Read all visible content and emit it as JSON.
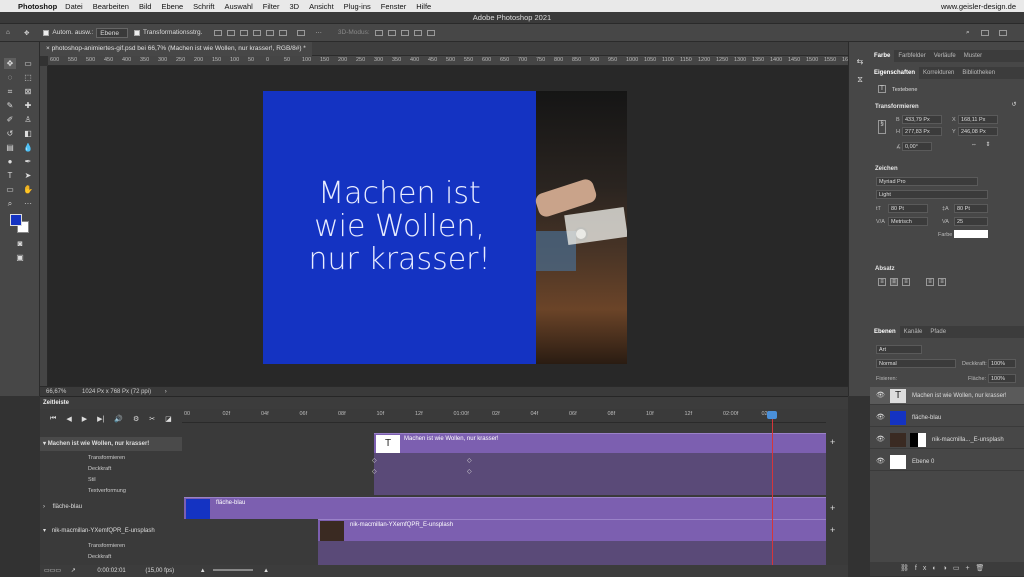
{
  "menubar": {
    "app": "Photoshop",
    "items": [
      "Datei",
      "Bearbeiten",
      "Bild",
      "Ebene",
      "Schrift",
      "Auswahl",
      "Filter",
      "3D",
      "Ansicht",
      "Plug-ins",
      "Fenster",
      "Hilfe"
    ],
    "right_text": "www.geisler-design.de"
  },
  "window_title": "Adobe Photoshop 2021",
  "options": {
    "auto_select_label": "Autom. ausw.:",
    "auto_select_value": "Ebene",
    "transform_label": "Transformationsstrg.",
    "mode_3d": "3D-Modus:"
  },
  "document": {
    "tab": "photoshop-animiertes-gif.psd bei 66,7% (Machen ist wie Wollen, nur krasser!, RGB/8#) *",
    "headline_line1": "Machen ist",
    "headline_line2": "wie Wollen,",
    "headline_line3": "nur krasser!",
    "zoom": "66,67%",
    "size": "1024 Px x 768 Px (72 ppi)",
    "ruler_labels": [
      "600",
      "550",
      "500",
      "450",
      "400",
      "350",
      "300",
      "250",
      "200",
      "150",
      "100",
      "50",
      "0",
      "50",
      "100",
      "150",
      "200",
      "250",
      "300",
      "350",
      "400",
      "450",
      "500",
      "550",
      "600",
      "650",
      "700",
      "750",
      "800",
      "850",
      "900",
      "950",
      "1000",
      "1050",
      "1100",
      "1150",
      "1200",
      "1250",
      "1300",
      "1350",
      "1400",
      "1450",
      "1500",
      "1550",
      "1600"
    ]
  },
  "panels": {
    "top_tabs": [
      "Farbe",
      "Farbfelder",
      "Verläufe",
      "Muster"
    ],
    "prop_tabs": [
      "Eigenschaften",
      "Korrekturen",
      "Bibliotheken"
    ],
    "layer_type": "Textebene",
    "transform_title": "Transformieren",
    "transform": {
      "b": "433,79 Px",
      "h": "277,83 Px",
      "x": "168,11 Px",
      "y": "246,08 Px",
      "angle": "0,00°"
    },
    "char_title": "Zeichen",
    "font": "Myriad Pro",
    "style": "Light",
    "size": "80 Pt",
    "leading": "80 Pt",
    "kerning": "Metrisch",
    "tracking": "25",
    "color_label": "Farbe",
    "para_title": "Absatz",
    "layer_tabs": [
      "Ebenen",
      "Kanäle",
      "Pfade"
    ],
    "filter_kind": "Art",
    "blend_mode": "Normal",
    "opacity_label": "Deckkraft:",
    "opacity": "100%",
    "lock_label": "Fixieren:",
    "fill_label": "Fläche:",
    "fill": "100%",
    "layers": [
      {
        "name": "Machen ist wie Wollen, nur krasser!",
        "type": "text"
      },
      {
        "name": "fläche-blau",
        "type": "blue"
      },
      {
        "name": "nik-macmilla..._E-unsplash",
        "type": "photo"
      },
      {
        "name": "Ebene 0",
        "type": "white"
      }
    ]
  },
  "timeline": {
    "title": "Zeitleiste",
    "ticks": [
      "00",
      "02f",
      "04f",
      "06f",
      "08f",
      "10f",
      "12f",
      "01:00f",
      "02f",
      "04f",
      "06f",
      "08f",
      "10f",
      "12f",
      "02:00f",
      "02f"
    ],
    "track1": "Machen ist wie Wollen, nur krasser!",
    "track1_sub": [
      "Transformieren",
      "Deckkraft",
      "Stil",
      "Textverformung"
    ],
    "track2": "fläche-blau",
    "track3": "nik-macmillan-YXemfQPR_E-unsplash",
    "track3_sub": [
      "Transformieren",
      "Deckkraft"
    ],
    "clip_text": "Machen ist wie Wollen, nur krasser!",
    "clip_blue": "fläche-blau",
    "clip_photo": "nik-macmillan-YXemfQPR_E-unsplash",
    "time": "0:00:02:01",
    "fps": "(15,00 fps)"
  }
}
